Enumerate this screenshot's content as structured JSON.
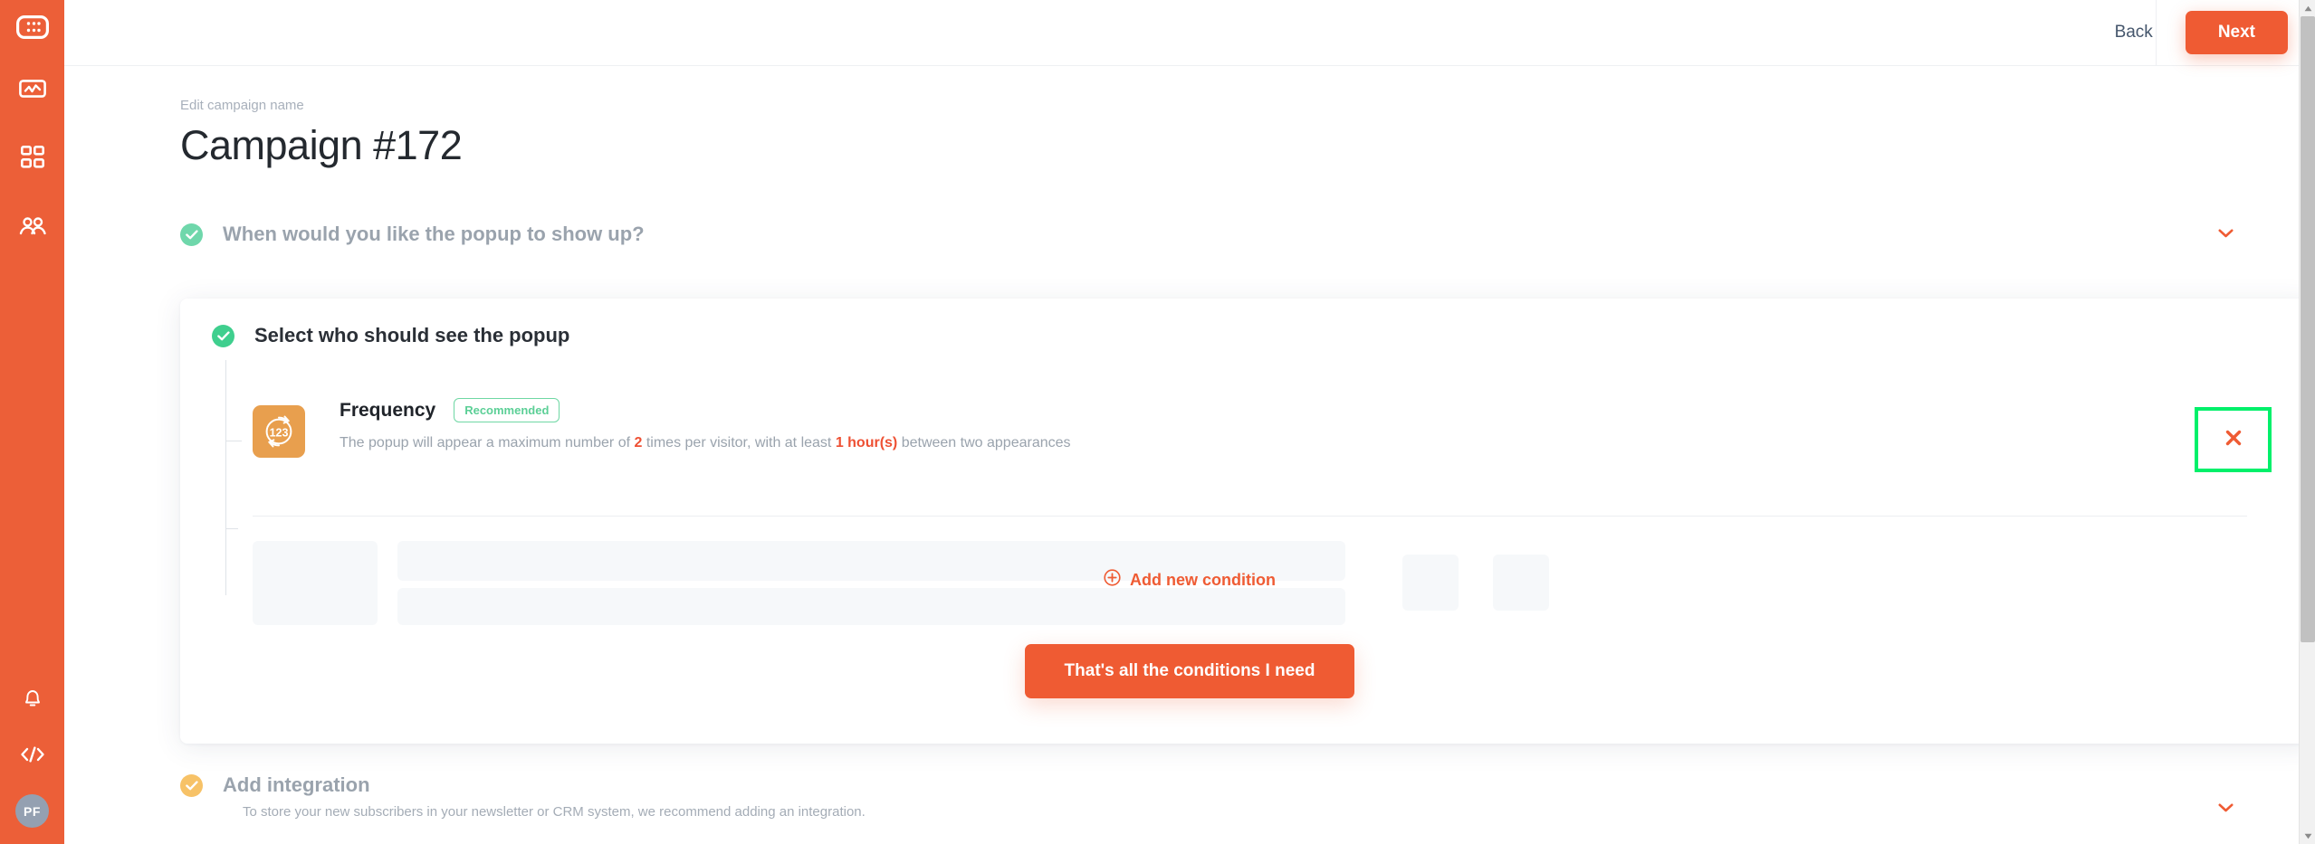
{
  "sidebar": {
    "logo_icon": "grid-dots-logo-icon",
    "items": [
      {
        "icon": "analytics-icon",
        "name": "analytics"
      },
      {
        "icon": "dashboard-grid-icon",
        "name": "dashboard"
      },
      {
        "icon": "users-icon",
        "name": "users"
      }
    ],
    "bottom_items": [
      {
        "icon": "bell-icon",
        "name": "notifications"
      },
      {
        "icon": "code-icon",
        "name": "embed-code"
      }
    ],
    "avatar_initials": "PF",
    "avatar_color": "#94a0b1",
    "background_color": "#ec5f38"
  },
  "header": {
    "back_label": "Back",
    "next_label": "Next",
    "next_color": "#ef5b33"
  },
  "page": {
    "eyebrow": "Edit campaign name",
    "title": "Campaign #172"
  },
  "sections": [
    {
      "id": "timing",
      "title": "When would you like the popup to show up?",
      "status_icon": "check-circle-icon",
      "status_color": "#6fd7ab",
      "chevron_icon": "chevron-down-icon",
      "collapsed": true
    },
    {
      "id": "audience",
      "title": "Select who should see the popup",
      "status_icon": "check-circle-icon",
      "status_color": "#3fcf8e",
      "collapsed": false
    },
    {
      "id": "integration",
      "title": "Add integration",
      "subtitle": "To store your new subscribers in your newsletter or CRM system, we recommend adding an integration.",
      "status_icon": "check-circle-icon",
      "status_color": "#f7c267",
      "chevron_icon": "chevron-down-icon",
      "collapsed": true
    }
  ],
  "condition": {
    "icon": "frequency-123-icon",
    "icon_background": "#e89f4e",
    "title": "Frequency",
    "badge": "Recommended",
    "badge_color": "#5bcf96",
    "description_parts": {
      "p1": "The popup will appear a maximum number of ",
      "v1": "2",
      "p2": " times per visitor, with at least ",
      "v2": "1 hour(s)",
      "p3": " between two appearances"
    },
    "delete_icon": "close-x-icon",
    "delete_icon_color": "#ef5b33",
    "highlight_color": "#00f06a"
  },
  "actions": {
    "add_condition_label": "Add new condition",
    "add_condition_icon": "plus-circle-icon",
    "add_condition_color": "#ef5b33",
    "cta_label": "That's all the conditions I need",
    "cta_color": "#ef5b33"
  }
}
